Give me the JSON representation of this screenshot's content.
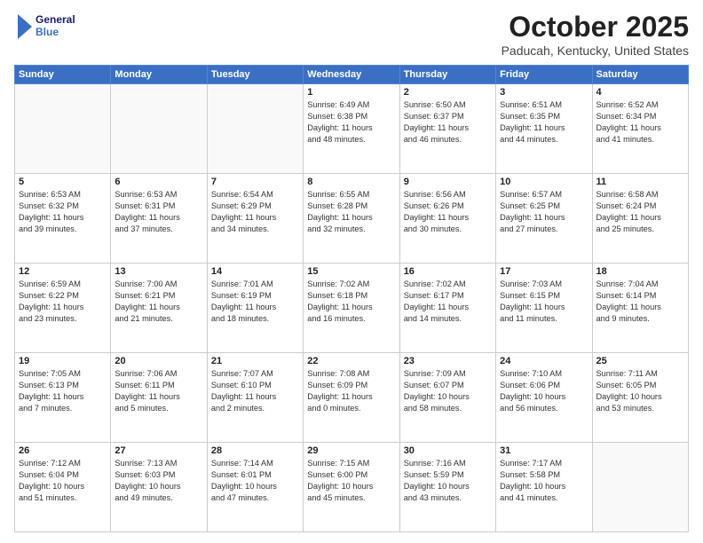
{
  "header": {
    "logo_line1": "General",
    "logo_line2": "Blue",
    "month": "October 2025",
    "location": "Paducah, Kentucky, United States"
  },
  "weekdays": [
    "Sunday",
    "Monday",
    "Tuesday",
    "Wednesday",
    "Thursday",
    "Friday",
    "Saturday"
  ],
  "weeks": [
    [
      {
        "day": "",
        "content": ""
      },
      {
        "day": "",
        "content": ""
      },
      {
        "day": "",
        "content": ""
      },
      {
        "day": "1",
        "content": "Sunrise: 6:49 AM\nSunset: 6:38 PM\nDaylight: 11 hours\nand 48 minutes."
      },
      {
        "day": "2",
        "content": "Sunrise: 6:50 AM\nSunset: 6:37 PM\nDaylight: 11 hours\nand 46 minutes."
      },
      {
        "day": "3",
        "content": "Sunrise: 6:51 AM\nSunset: 6:35 PM\nDaylight: 11 hours\nand 44 minutes."
      },
      {
        "day": "4",
        "content": "Sunrise: 6:52 AM\nSunset: 6:34 PM\nDaylight: 11 hours\nand 41 minutes."
      }
    ],
    [
      {
        "day": "5",
        "content": "Sunrise: 6:53 AM\nSunset: 6:32 PM\nDaylight: 11 hours\nand 39 minutes."
      },
      {
        "day": "6",
        "content": "Sunrise: 6:53 AM\nSunset: 6:31 PM\nDaylight: 11 hours\nand 37 minutes."
      },
      {
        "day": "7",
        "content": "Sunrise: 6:54 AM\nSunset: 6:29 PM\nDaylight: 11 hours\nand 34 minutes."
      },
      {
        "day": "8",
        "content": "Sunrise: 6:55 AM\nSunset: 6:28 PM\nDaylight: 11 hours\nand 32 minutes."
      },
      {
        "day": "9",
        "content": "Sunrise: 6:56 AM\nSunset: 6:26 PM\nDaylight: 11 hours\nand 30 minutes."
      },
      {
        "day": "10",
        "content": "Sunrise: 6:57 AM\nSunset: 6:25 PM\nDaylight: 11 hours\nand 27 minutes."
      },
      {
        "day": "11",
        "content": "Sunrise: 6:58 AM\nSunset: 6:24 PM\nDaylight: 11 hours\nand 25 minutes."
      }
    ],
    [
      {
        "day": "12",
        "content": "Sunrise: 6:59 AM\nSunset: 6:22 PM\nDaylight: 11 hours\nand 23 minutes."
      },
      {
        "day": "13",
        "content": "Sunrise: 7:00 AM\nSunset: 6:21 PM\nDaylight: 11 hours\nand 21 minutes."
      },
      {
        "day": "14",
        "content": "Sunrise: 7:01 AM\nSunset: 6:19 PM\nDaylight: 11 hours\nand 18 minutes."
      },
      {
        "day": "15",
        "content": "Sunrise: 7:02 AM\nSunset: 6:18 PM\nDaylight: 11 hours\nand 16 minutes."
      },
      {
        "day": "16",
        "content": "Sunrise: 7:02 AM\nSunset: 6:17 PM\nDaylight: 11 hours\nand 14 minutes."
      },
      {
        "day": "17",
        "content": "Sunrise: 7:03 AM\nSunset: 6:15 PM\nDaylight: 11 hours\nand 11 minutes."
      },
      {
        "day": "18",
        "content": "Sunrise: 7:04 AM\nSunset: 6:14 PM\nDaylight: 11 hours\nand 9 minutes."
      }
    ],
    [
      {
        "day": "19",
        "content": "Sunrise: 7:05 AM\nSunset: 6:13 PM\nDaylight: 11 hours\nand 7 minutes."
      },
      {
        "day": "20",
        "content": "Sunrise: 7:06 AM\nSunset: 6:11 PM\nDaylight: 11 hours\nand 5 minutes."
      },
      {
        "day": "21",
        "content": "Sunrise: 7:07 AM\nSunset: 6:10 PM\nDaylight: 11 hours\nand 2 minutes."
      },
      {
        "day": "22",
        "content": "Sunrise: 7:08 AM\nSunset: 6:09 PM\nDaylight: 11 hours\nand 0 minutes."
      },
      {
        "day": "23",
        "content": "Sunrise: 7:09 AM\nSunset: 6:07 PM\nDaylight: 10 hours\nand 58 minutes."
      },
      {
        "day": "24",
        "content": "Sunrise: 7:10 AM\nSunset: 6:06 PM\nDaylight: 10 hours\nand 56 minutes."
      },
      {
        "day": "25",
        "content": "Sunrise: 7:11 AM\nSunset: 6:05 PM\nDaylight: 10 hours\nand 53 minutes."
      }
    ],
    [
      {
        "day": "26",
        "content": "Sunrise: 7:12 AM\nSunset: 6:04 PM\nDaylight: 10 hours\nand 51 minutes."
      },
      {
        "day": "27",
        "content": "Sunrise: 7:13 AM\nSunset: 6:03 PM\nDaylight: 10 hours\nand 49 minutes."
      },
      {
        "day": "28",
        "content": "Sunrise: 7:14 AM\nSunset: 6:01 PM\nDaylight: 10 hours\nand 47 minutes."
      },
      {
        "day": "29",
        "content": "Sunrise: 7:15 AM\nSunset: 6:00 PM\nDaylight: 10 hours\nand 45 minutes."
      },
      {
        "day": "30",
        "content": "Sunrise: 7:16 AM\nSunset: 5:59 PM\nDaylight: 10 hours\nand 43 minutes."
      },
      {
        "day": "31",
        "content": "Sunrise: 7:17 AM\nSunset: 5:58 PM\nDaylight: 10 hours\nand 41 minutes."
      },
      {
        "day": "",
        "content": ""
      }
    ]
  ]
}
